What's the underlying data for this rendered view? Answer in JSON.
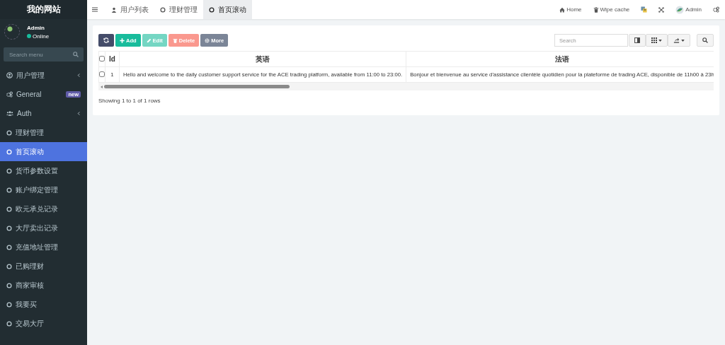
{
  "sidebar": {
    "site_title": "我的网站",
    "user": {
      "name": "Admin",
      "status": "Online"
    },
    "search": {
      "placeholder": "Search menu"
    },
    "items": [
      {
        "label": "用户管理",
        "kind": "user-circle",
        "expanded": false,
        "selected": false
      },
      {
        "label": "General",
        "kind": "gears",
        "badge": "new",
        "selected": false
      },
      {
        "label": "Auth",
        "kind": "users",
        "expanded": false,
        "selected": false
      },
      {
        "label": "理财管理",
        "kind": "circle",
        "selected": false
      },
      {
        "label": "首页滚动",
        "kind": "circle",
        "selected": true
      },
      {
        "label": "货币参数设置",
        "kind": "circle",
        "selected": false
      },
      {
        "label": "账户绑定管理",
        "kind": "circle",
        "selected": false
      },
      {
        "label": "欧元承兑记录",
        "kind": "circle",
        "selected": false
      },
      {
        "label": "大厅卖出记录",
        "kind": "circle",
        "selected": false
      },
      {
        "label": "充值地址管理",
        "kind": "circle",
        "selected": false
      },
      {
        "label": "已购理财",
        "kind": "circle",
        "selected": false
      },
      {
        "label": "商家审核",
        "kind": "circle",
        "selected": false
      },
      {
        "label": "我要买",
        "kind": "circle",
        "selected": false
      },
      {
        "label": "交易大厅",
        "kind": "circle",
        "selected": false
      }
    ]
  },
  "topbar": {
    "tabs": [
      {
        "label": "用户列表",
        "kind": "user",
        "selected": false
      },
      {
        "label": "理财管理",
        "kind": "circle",
        "selected": false
      },
      {
        "label": "首页滚动",
        "kind": "circle",
        "selected": true
      }
    ],
    "nav": [
      {
        "label": "Home",
        "kind": "home"
      },
      {
        "label": "Wipe cache",
        "kind": "trash"
      },
      {
        "kind": "translate"
      },
      {
        "kind": "fullscreen"
      },
      {
        "label": "Admin",
        "kind": "avatar"
      },
      {
        "kind": "gears"
      }
    ]
  },
  "toolbar": {
    "buttons": [
      {
        "kind": "refresh",
        "disabled": false
      },
      {
        "label": "Add",
        "kind": "add",
        "disabled": false
      },
      {
        "label": "Edit",
        "kind": "edit",
        "disabled": true
      },
      {
        "label": "Delete",
        "kind": "delete",
        "disabled": true
      },
      {
        "label": "More",
        "kind": "more",
        "disabled": false
      }
    ],
    "search": {
      "placeholder": "Search"
    },
    "tools": [
      {
        "kind": "columns-view"
      },
      {
        "kind": "grid",
        "dropdown": true
      },
      {
        "kind": "export",
        "dropdown": true
      },
      {
        "kind": "search"
      }
    ]
  },
  "table": {
    "all_checked": false,
    "columns": [
      "Id",
      "英语",
      "法语"
    ],
    "rows": [
      {
        "checked": false,
        "cells": [
          "1",
          "Hello and welcome to the daily customer support service for the ACE trading platform, available from 11:00 to 23:00.",
          "Bonjour et bienvenue au service d'assistance clientèle quotidien pour la plateforme de trading ACE, disponible de 11h00 à 23h"
        ]
      }
    ]
  },
  "pagination": {
    "summary": "Showing 1 to 1 of 1 rows"
  }
}
